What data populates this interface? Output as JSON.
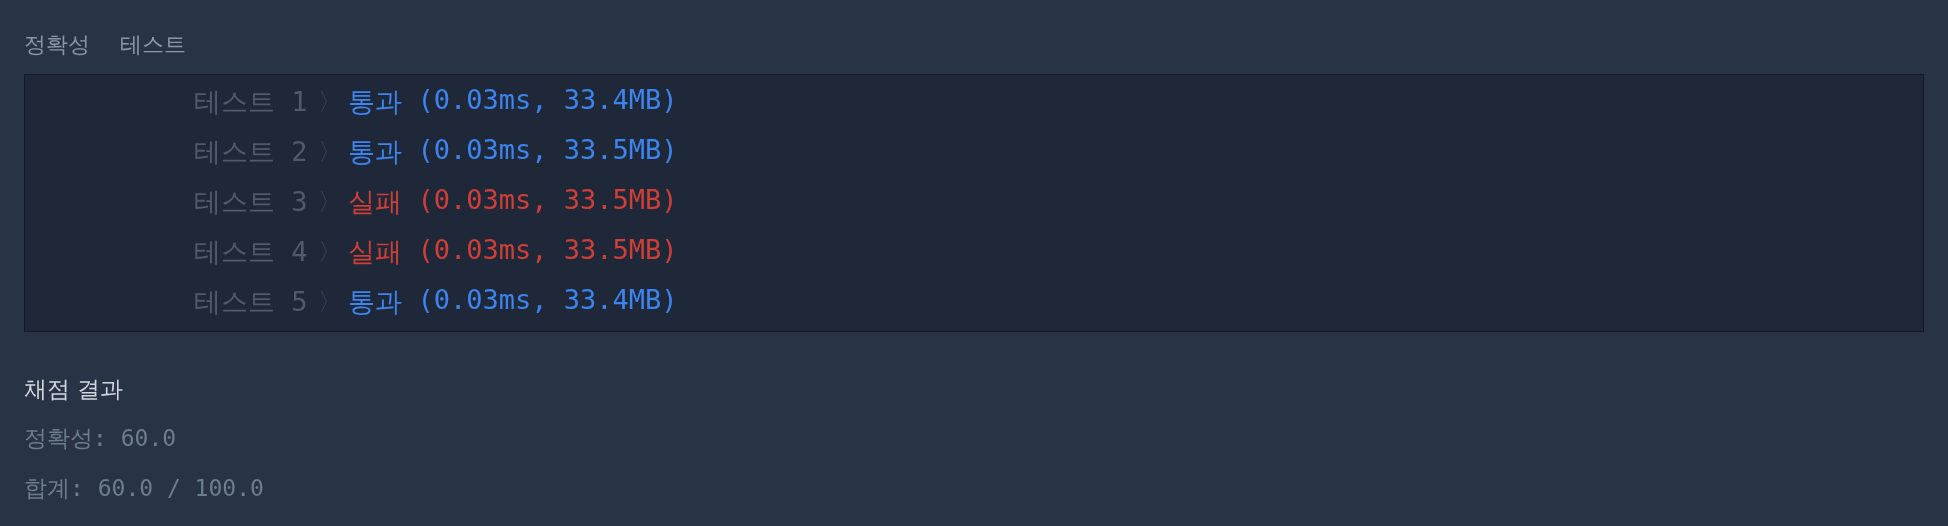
{
  "section_title": [
    "정확성",
    "테스트"
  ],
  "test_results": [
    {
      "label": "테스트 1",
      "arrow": "〉",
      "status": "통과",
      "detail": "(0.03ms, 33.4MB)",
      "kind": "pass"
    },
    {
      "label": "테스트 2",
      "arrow": "〉",
      "status": "통과",
      "detail": "(0.03ms, 33.5MB)",
      "kind": "pass"
    },
    {
      "label": "테스트 3",
      "arrow": "〉",
      "status": "실패",
      "detail": "(0.03ms, 33.5MB)",
      "kind": "fail"
    },
    {
      "label": "테스트 4",
      "arrow": "〉",
      "status": "실패",
      "detail": "(0.03ms, 33.5MB)",
      "kind": "fail"
    },
    {
      "label": "테스트 5",
      "arrow": "〉",
      "status": "통과",
      "detail": "(0.03ms, 33.4MB)",
      "kind": "pass"
    }
  ],
  "grading": {
    "title": "채점 결과",
    "lines": [
      "정확성: 60.0",
      "합계: 60.0 / 100.0"
    ]
  }
}
